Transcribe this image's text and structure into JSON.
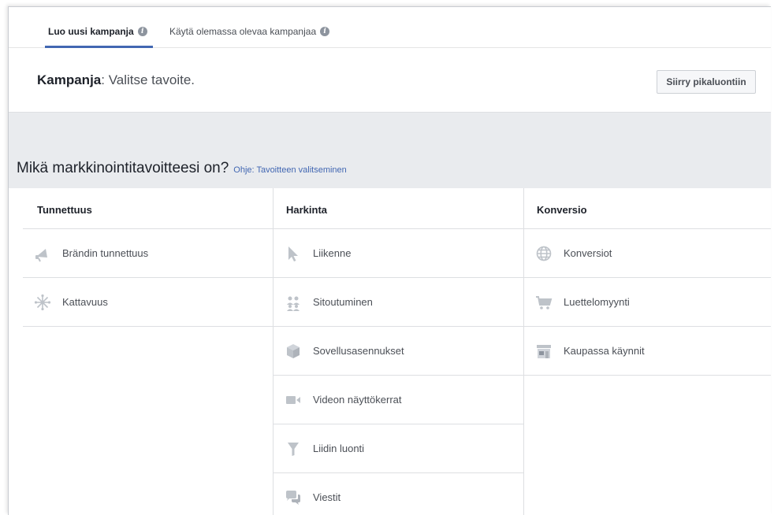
{
  "tabs": [
    {
      "label": "Luo uusi kampanja"
    },
    {
      "label": "Käytä olemassa olevaa kampanjaa"
    }
  ],
  "info_glyph": "i",
  "header": {
    "title_bold": "Kampanja",
    "title_rest": ": Valitse tavoite.",
    "quick_button": "Siirry pikaluontiin"
  },
  "question": {
    "text": "Mikä markkinointitavoitteesi on?",
    "help_link": "Ohje: Tavoitteen valitseminen"
  },
  "columns": [
    {
      "heading": "Tunnettuus",
      "items": [
        {
          "label": "Brändin tunnettuus",
          "icon": "megaphone-icon"
        },
        {
          "label": "Kattavuus",
          "icon": "reach-icon"
        }
      ]
    },
    {
      "heading": "Harkinta",
      "items": [
        {
          "label": "Liikenne",
          "icon": "cursor-icon"
        },
        {
          "label": "Sitoutuminen",
          "icon": "people-icon"
        },
        {
          "label": "Sovellusasennukset",
          "icon": "cube-icon"
        },
        {
          "label": "Videon näyttökerrat",
          "icon": "video-camera-icon"
        },
        {
          "label": "Liidin luonti",
          "icon": "funnel-icon"
        },
        {
          "label": "Viestit",
          "icon": "chat-bubbles-icon"
        }
      ]
    },
    {
      "heading": "Konversio",
      "items": [
        {
          "label": "Konversiot",
          "icon": "globe-icon"
        },
        {
          "label": "Luettelomyynti",
          "icon": "shopping-cart-icon"
        },
        {
          "label": "Kaupassa käynnit",
          "icon": "store-icon"
        }
      ]
    }
  ],
  "colors": {
    "accent": "#4267b2",
    "icon": "#bec3c9",
    "band": "#e9ebee"
  }
}
